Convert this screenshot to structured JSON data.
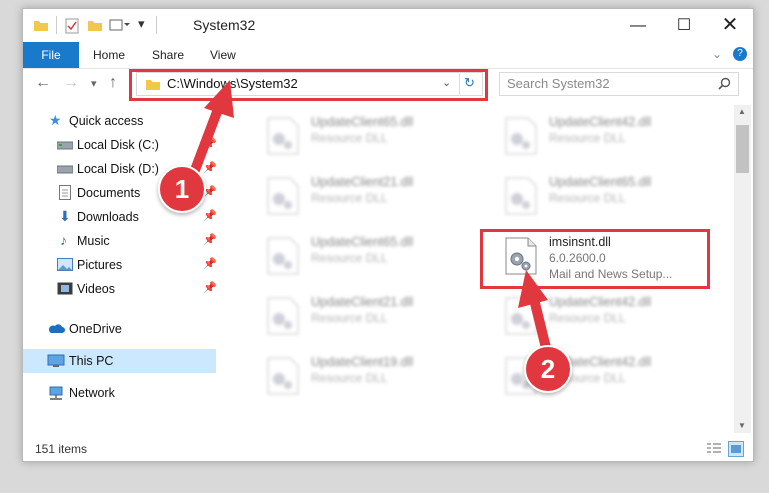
{
  "window": {
    "title": "System32"
  },
  "ribbon": {
    "tabs": [
      "File",
      "Home",
      "Share",
      "View"
    ]
  },
  "address": {
    "path": "C:\\Windows\\System32"
  },
  "search": {
    "placeholder": "Search System32"
  },
  "nav_items": [
    {
      "label": "Quick access",
      "icon": "star-icon"
    },
    {
      "label": "Local Disk (C:)",
      "icon": "drive-icon"
    },
    {
      "label": "Local Disk (D:)",
      "icon": "drive-icon"
    },
    {
      "label": "Documents",
      "icon": "documents-icon"
    },
    {
      "label": "Downloads",
      "icon": "download-icon"
    },
    {
      "label": "Music",
      "icon": "music-icon"
    },
    {
      "label": "Pictures",
      "icon": "pictures-icon"
    },
    {
      "label": "Videos",
      "icon": "videos-icon"
    },
    {
      "label": "OneDrive",
      "icon": "cloud-icon"
    },
    {
      "label": "This PC",
      "icon": "computer-icon",
      "selected": true
    },
    {
      "label": "Network",
      "icon": "network-icon"
    }
  ],
  "files": [
    {
      "name": "UpdateClient65.dll",
      "type": "Resource DLL"
    },
    {
      "name": "UpdateClient42.dll",
      "type": "Resource DLL"
    },
    {
      "name": "UpdateClient21.dll",
      "type": "Resource DLL"
    },
    {
      "name": "UpdateClient65.dll",
      "type": "Resource DLL"
    },
    {
      "name": "UpdateClient65.dll",
      "type": "Resource DLL"
    },
    {
      "name": "imsinsnt.dll",
      "version": "6.0.2600.0",
      "type": "Mail and News Setup...",
      "highlighted": true
    },
    {
      "name": "UpdateClient21.dll",
      "type": "Resource DLL"
    },
    {
      "name": "UpdateClient42.dll",
      "type": "Resource DLL"
    },
    {
      "name": "UpdateClient19.dll",
      "type": "Resource DLL"
    },
    {
      "name": "UpdateClient42.dll",
      "type": "Resource DLL"
    }
  ],
  "status": {
    "item_count": "151 items"
  },
  "markers": [
    "1",
    "2"
  ],
  "colors": {
    "accent": "#1979ca",
    "highlight": "#e0383e"
  }
}
